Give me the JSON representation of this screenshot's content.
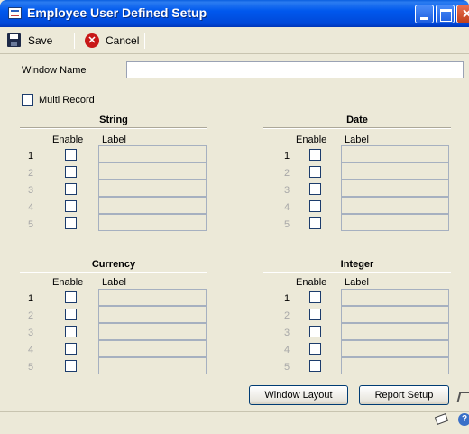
{
  "window": {
    "title": "Employee User Defined Setup"
  },
  "toolbar": {
    "save_label": "Save",
    "cancel_label": "Cancel"
  },
  "form": {
    "window_name_label": "Window Name",
    "window_name_value": "",
    "multi_record_label": "Multi Record"
  },
  "sections": {
    "string": {
      "title": "String",
      "enable_header": "Enable",
      "label_header": "Label",
      "rows": [
        "1",
        "2",
        "3",
        "4",
        "5"
      ]
    },
    "date": {
      "title": "Date",
      "enable_header": "Enable",
      "label_header": "Label",
      "rows": [
        "1",
        "2",
        "3",
        "4",
        "5"
      ]
    },
    "currency": {
      "title": "Currency",
      "enable_header": "Enable",
      "label_header": "Label",
      "rows": [
        "1",
        "2",
        "3",
        "4",
        "5"
      ]
    },
    "integer": {
      "title": "Integer",
      "enable_header": "Enable",
      "label_header": "Label",
      "rows": [
        "1",
        "2",
        "3",
        "4",
        "5"
      ]
    }
  },
  "buttons": {
    "window_layout": "Window Layout",
    "report_setup": "Report Setup"
  },
  "colors": {
    "titlebar": "#0058ee",
    "background": "#ece9d8",
    "cancel_icon": "#c81818"
  }
}
